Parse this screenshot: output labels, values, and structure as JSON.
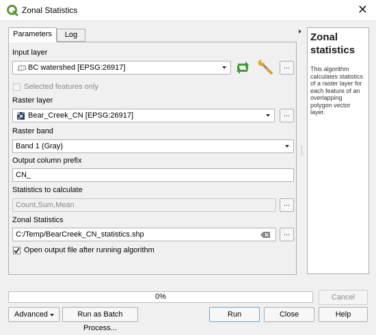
{
  "window": {
    "title": "Zonal Statistics",
    "close_glyph": "✕"
  },
  "tabs": [
    {
      "label": "Parameters"
    },
    {
      "label": "Log"
    }
  ],
  "form": {
    "input_layer": {
      "label": "Input layer",
      "value": "BC watershed [EPSG:26917]"
    },
    "selected_only": {
      "label": "Selected features only",
      "checked": false
    },
    "raster_layer": {
      "label": "Raster layer",
      "value": "Bear_Creek_CN [EPSG:26917]"
    },
    "raster_band": {
      "label": "Raster band",
      "value": "Band 1 (Gray)"
    },
    "prefix": {
      "label": "Output column prefix",
      "value": "CN_"
    },
    "stats": {
      "label": "Statistics to calculate",
      "value": "Count,Sum,Mean"
    },
    "output": {
      "label": "Zonal Statistics",
      "value": "C:/Temp/BearCreek_CN_statistics.shp"
    },
    "open_output": {
      "label": "Open output file after running algorithm",
      "checked": true
    },
    "dots_label": "..."
  },
  "help": {
    "title": "Zonal statistics",
    "text": "This algorithm calculates statistics of a raster layer for each feature of an overlapping polygon vector layer."
  },
  "progress": {
    "text": "0%",
    "value": 0
  },
  "buttons": {
    "cancel": "Cancel",
    "advanced": "Advanced",
    "batch": "Run as Batch Process...",
    "run": "Run",
    "close": "Close",
    "help": "Help"
  },
  "icons": {
    "app": "qgis-icon",
    "polygon_layer": "polygon-layer-icon",
    "raster_layer": "raster-layer-icon",
    "iterate": "iterate-icon",
    "settings": "wrench-icon",
    "clear": "clear-icon"
  }
}
